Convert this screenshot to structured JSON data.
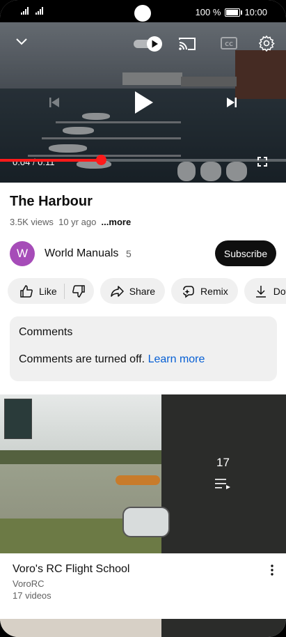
{
  "status_bar": {
    "battery": "100 %",
    "time": "10:00",
    "battery_level": 1.0
  },
  "player": {
    "time_current": "0:04",
    "time_total": "0:11",
    "progress": 0.354,
    "autoplay_on": true
  },
  "video": {
    "title": "The Harbour",
    "views": "3.5K views",
    "age": "10 yr ago",
    "more_label": "...more"
  },
  "channel": {
    "avatar_letter": "W",
    "name": "World Manuals",
    "subscribers": "5",
    "subscribe_label": "Subscribe",
    "avatar_color": "#a64cb8"
  },
  "actions": {
    "like": "Like",
    "share": "Share",
    "remix": "Remix",
    "download": "Dov"
  },
  "comments": {
    "heading": "Comments",
    "text": "Comments are turned off.",
    "link": "Learn more"
  },
  "playlist": {
    "count": "17",
    "title": "Voro's RC Flight School",
    "channel": "VoroRC",
    "videos": "17 videos"
  },
  "colors": {
    "accent": "#ff1a1a",
    "link": "#065fd4",
    "chip_bg": "#f0f0f0"
  }
}
